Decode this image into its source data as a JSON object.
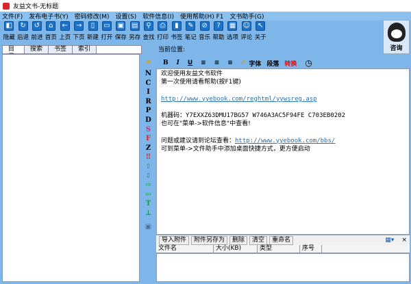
{
  "window": {
    "title": "友益文书-无标题"
  },
  "menu": [
    "文件(F)",
    "发布电子书(Y)",
    "密码修改(M)",
    "设置(S)",
    "软件信息(I)",
    "使用帮助(H) F1",
    "文书助手(G)"
  ],
  "toolbar": [
    {
      "label": "隐藏",
      "icon": "hide-icon",
      "g": "◧"
    },
    {
      "label": "后退",
      "icon": "refresh-back-icon",
      "g": "↻"
    },
    {
      "label": "前进",
      "icon": "forward-icon",
      "g": "↺"
    },
    {
      "label": "首页",
      "icon": "home-icon",
      "g": "⌂"
    },
    {
      "label": "上页",
      "icon": "arrow-left-icon",
      "g": "←"
    },
    {
      "label": "下页",
      "icon": "arrow-right-icon",
      "g": "→"
    },
    {
      "label": "新建",
      "icon": "new-file-icon",
      "g": "▯"
    },
    {
      "label": "打开",
      "icon": "open-folder-icon",
      "g": "▭"
    },
    {
      "label": "保存",
      "icon": "save-icon",
      "g": "▣"
    },
    {
      "label": "另存",
      "icon": "save-as-icon",
      "g": "▤"
    },
    {
      "label": "查找",
      "icon": "search-icon",
      "g": "⚲"
    },
    {
      "label": "打印",
      "icon": "print-icon",
      "g": "⎙"
    },
    {
      "label": "书签",
      "icon": "bookmark-icon",
      "g": "▮"
    },
    {
      "label": "笔记",
      "icon": "note-icon",
      "g": "✎"
    },
    {
      "label": "音乐",
      "icon": "music-icon",
      "g": "⊘"
    },
    {
      "label": "帮助",
      "icon": "help-icon",
      "g": "?"
    },
    {
      "label": "选项",
      "icon": "options-icon",
      "g": "▦"
    },
    {
      "label": "评论",
      "icon": "comment-icon",
      "g": "☺"
    },
    {
      "label": "关于",
      "icon": "about-icon",
      "g": "↖"
    }
  ],
  "qq": {
    "label": "咨询"
  },
  "tabs": [
    "目录",
    "搜索",
    "书签",
    "索引"
  ],
  "address": {
    "label": "当前位置:"
  },
  "format": {
    "bold": "B",
    "italic": "I",
    "underline": "U",
    "font": "字体",
    "paragraph": "段落",
    "convert": "转换"
  },
  "strip": [
    {
      "t": "N",
      "c": "#000"
    },
    {
      "t": "C",
      "c": "#000"
    },
    {
      "t": "I",
      "c": "#000"
    },
    {
      "t": "R",
      "c": "#000"
    },
    {
      "t": "P",
      "c": "#000"
    },
    {
      "t": "D",
      "c": "#000"
    },
    {
      "t": "S",
      "c": "#c0308a"
    },
    {
      "t": "F",
      "c": "#e02020"
    },
    {
      "t": "Z",
      "c": "#000"
    },
    {
      "t": "‼",
      "c": "#e02020"
    },
    {
      "t": "⇧",
      "c": "#10a040"
    },
    {
      "t": "⇩",
      "c": "#10a040"
    },
    {
      "t": "⇨",
      "c": "#10a040"
    },
    {
      "t": "⇦",
      "c": "#10a040"
    },
    {
      "t": "T",
      "c": "#10a040"
    },
    {
      "t": "⊥",
      "c": "#10a040"
    }
  ],
  "editor": {
    "line1": "欢迎使用友益文书软件",
    "line2": "第一次使用请看帮助(按F1键)",
    "reg_link": "http://www.yyebook.com/reghtml/yywsreg.asp",
    "machine": "机器码：Y7EXXZ63DMU17BG57 W746A3AC5F94FE C703EB0202",
    "menu_hint": "也可在\"菜单->软件信息\"中查看!",
    "forum_text": "问题或建议请到论坛查看：",
    "forum_link": "http://www.yyebook.com/bbs/",
    "shortcut": "可到菜单->文件助手中添加桌面快捷方式，更方便启动"
  },
  "attachments": {
    "buttons": [
      "导入附件",
      "附件另存为",
      "删除",
      "清空",
      "重命名"
    ],
    "columns": [
      "文件名",
      "大小(KB)",
      "类型",
      "序号"
    ]
  }
}
